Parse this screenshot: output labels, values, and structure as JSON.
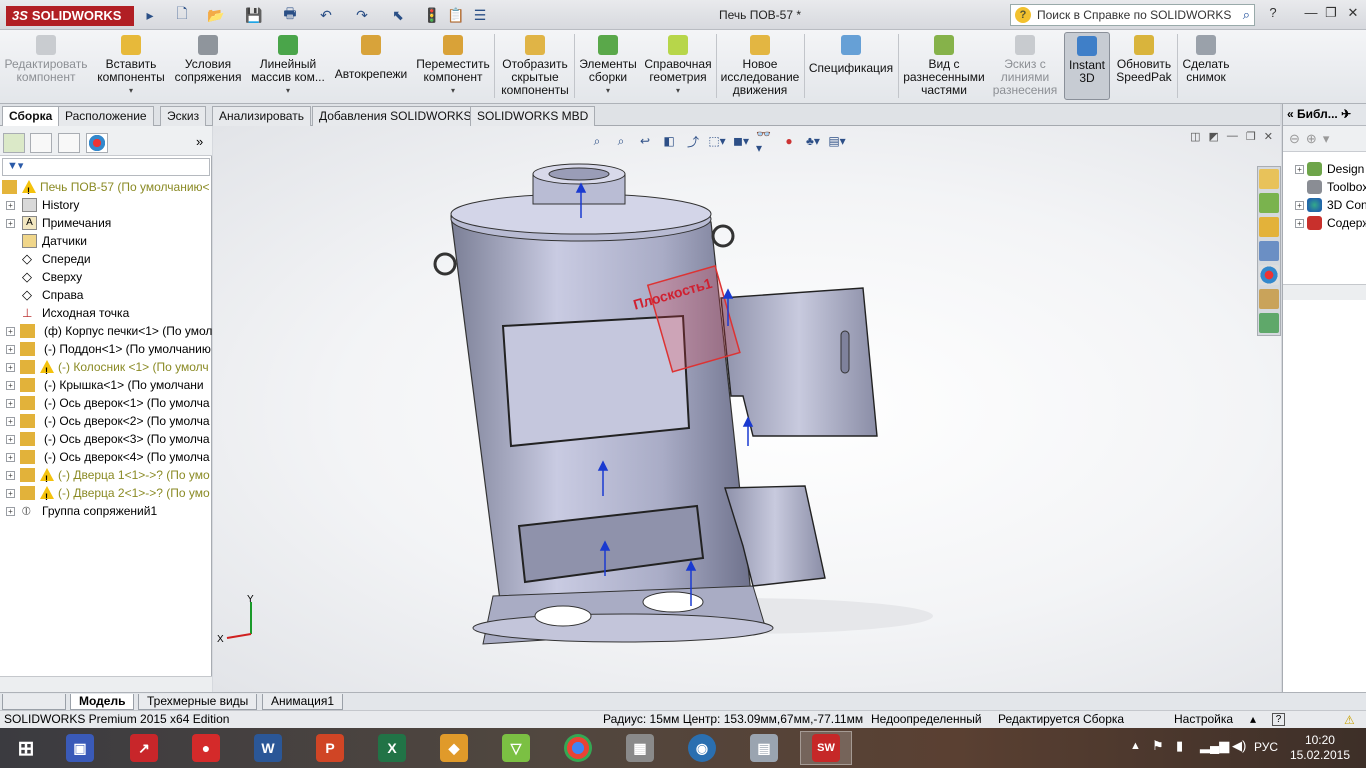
{
  "app": {
    "logo_text": "SOLIDWORKS",
    "doc_title": "Печь ПОВ-57 *",
    "help_search_placeholder": "Поиск в Справке по SOLIDWORKS"
  },
  "ribbon": {
    "buttons": [
      {
        "label": "Редактировать компонент",
        "enabled": false
      },
      {
        "label": "Вставить компоненты",
        "enabled": true
      },
      {
        "label": "Условия сопряжения",
        "enabled": true
      },
      {
        "label": "Линейный массив ком...",
        "enabled": true
      },
      {
        "label": "Автокрепежи",
        "enabled": true
      },
      {
        "label": "Переместить компонент",
        "enabled": true
      },
      {
        "label": "Отобразить скрытые компоненты",
        "enabled": true
      },
      {
        "label": "Элементы сборки",
        "enabled": true
      },
      {
        "label": "Справочная геометрия",
        "enabled": true
      },
      {
        "label": "Новое исследование движения",
        "enabled": true
      },
      {
        "label": "Спецификация",
        "enabled": true
      },
      {
        "label": "Вид с разнесенными частями",
        "enabled": true
      },
      {
        "label": "Эскиз с линиями разнесения",
        "enabled": false
      },
      {
        "label": "Instant 3D",
        "enabled": true
      },
      {
        "label": "Обновить SpeedPak",
        "enabled": true
      },
      {
        "label": "Сделать снимок",
        "enabled": true
      }
    ]
  },
  "tabs": [
    "Сборка",
    "Расположение",
    "Эскиз",
    "Анализировать",
    "Добавления SOLIDWORKS",
    "SOLIDWORKS MBD"
  ],
  "tree": [
    {
      "label": "Печь ПОВ-57  (По умолчанию<",
      "warn": true
    },
    {
      "label": "History"
    },
    {
      "label": "Примечания"
    },
    {
      "label": "Датчики"
    },
    {
      "label": "Спереди"
    },
    {
      "label": "Сверху"
    },
    {
      "label": "Справа"
    },
    {
      "label": "Исходная точка"
    },
    {
      "label": "(ф) Корпус печки<1> (По умол"
    },
    {
      "label": "(-) Поддон<1> (По умолчанию"
    },
    {
      "label": "(-) Колосник <1> (По умолч",
      "warn": true
    },
    {
      "label": "(-) Крышка<1> (По умолчани"
    },
    {
      "label": "(-) Ось дверок<1> (По умолча"
    },
    {
      "label": "(-) Ось дверок<2> (По умолча"
    },
    {
      "label": "(-) Ось дверок<3> (По умолча"
    },
    {
      "label": "(-) Ось дверок<4> (По умолча"
    },
    {
      "label": "(-) Дверца 1<1>->? (По умо",
      "warn": true
    },
    {
      "label": "(-) Дверца 2<1>->? (По умо",
      "warn": true
    },
    {
      "label": "Группа сопряжений1"
    }
  ],
  "viewport": {
    "plane_label": "Плоскость1",
    "axis_x": "X",
    "axis_y": "Y"
  },
  "taskpane": {
    "title": "Библ...",
    "items": [
      "Design",
      "Toolbox",
      "3D Con",
      "Содерж"
    ]
  },
  "bottom_tabs": [
    "Модель",
    "Трехмерные виды",
    "Анимация1"
  ],
  "status": {
    "edition": "SOLIDWORKS Premium 2015 x64 Edition",
    "measure": "Радиус: 15мм  Центр: 153.09мм,67мм,-77.11мм",
    "definition": "Недоопределенный",
    "editing": "Редактируется Сборка",
    "settings": "Настройка"
  },
  "taskbar": {
    "lang": "РУС",
    "time": "10:20",
    "date": "15.02.2015"
  }
}
